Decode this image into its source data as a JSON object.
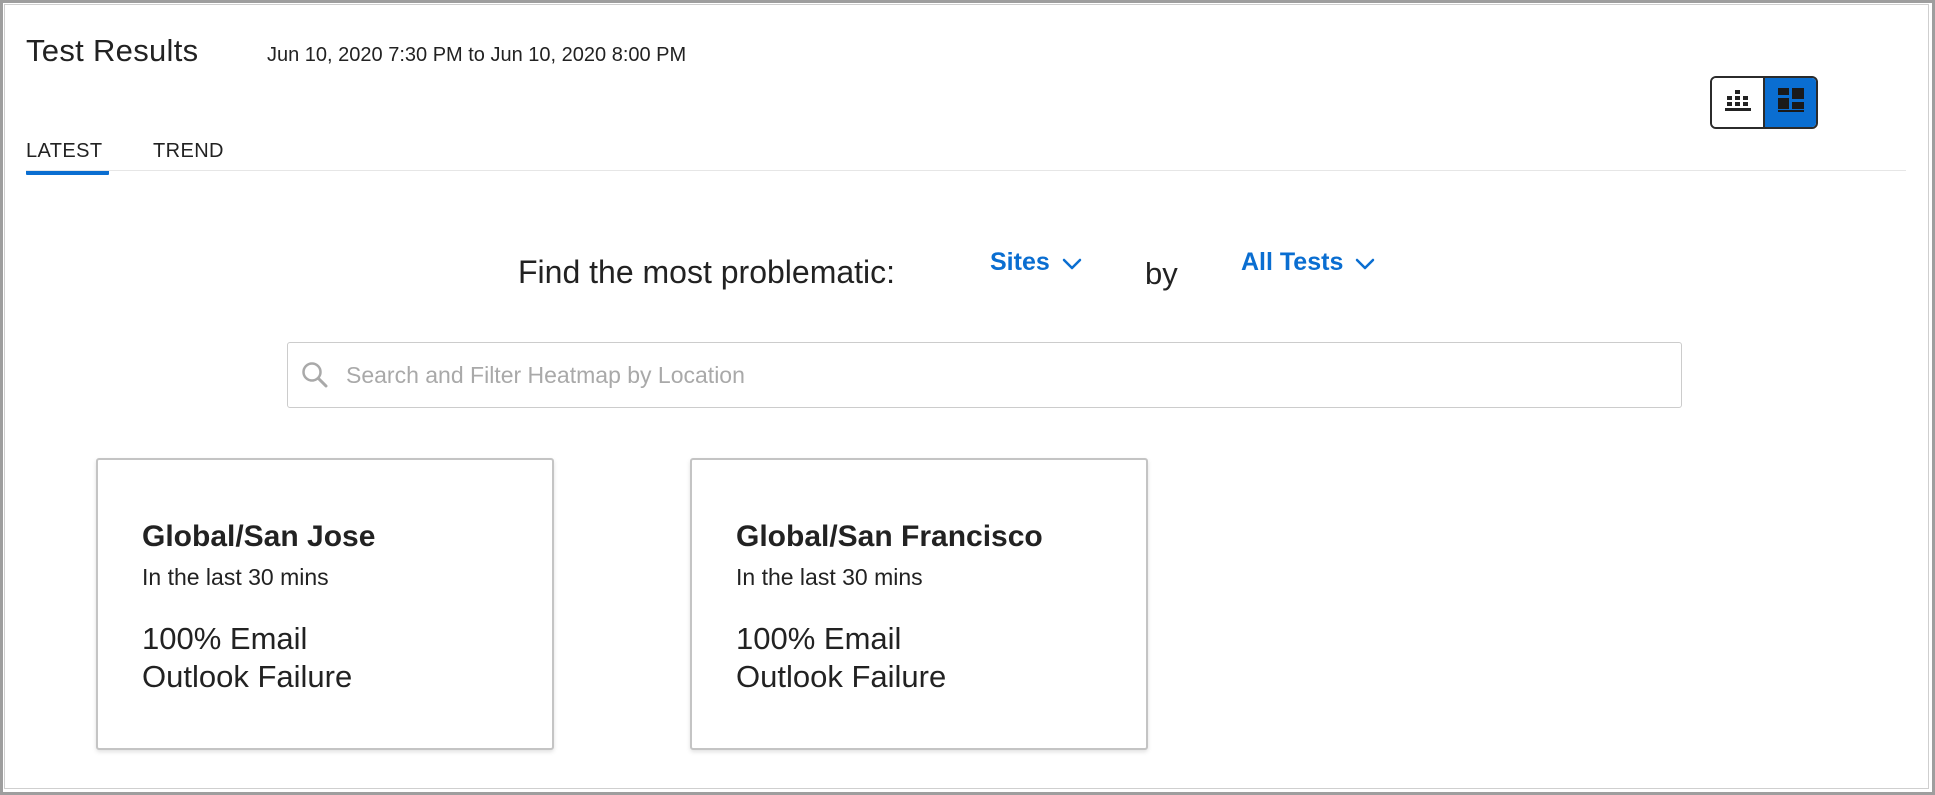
{
  "header": {
    "title": "Test Results",
    "time_range": "Jun 10, 2020 7:30 PM to Jun 10, 2020 8:00 PM"
  },
  "view_toggle": {
    "options": [
      {
        "icon": "heatmap-grid-icon",
        "active": false
      },
      {
        "icon": "card-view-icon",
        "active": true
      }
    ],
    "active_color": "#0a6ed1"
  },
  "tabs": [
    {
      "label": "LATEST",
      "active": true
    },
    {
      "label": "TREND",
      "active": false
    }
  ],
  "finder": {
    "label": "Find the most problematic:",
    "scope_dropdown": "Sites",
    "connector": "by",
    "test_dropdown": "All Tests"
  },
  "search": {
    "placeholder": "Search and Filter Heatmap by Location",
    "value": ""
  },
  "cards": [
    {
      "location": "Global/San Jose",
      "period": "In the last 30 mins",
      "metric_line1": "100% Email",
      "metric_line2": "Outlook Failure"
    },
    {
      "location": "Global/San Francisco",
      "period": "In the last 30 mins",
      "metric_line1": "100% Email",
      "metric_line2": "Outlook Failure"
    }
  ],
  "colors": {
    "accent": "#0a6ed1",
    "text": "#222222"
  }
}
